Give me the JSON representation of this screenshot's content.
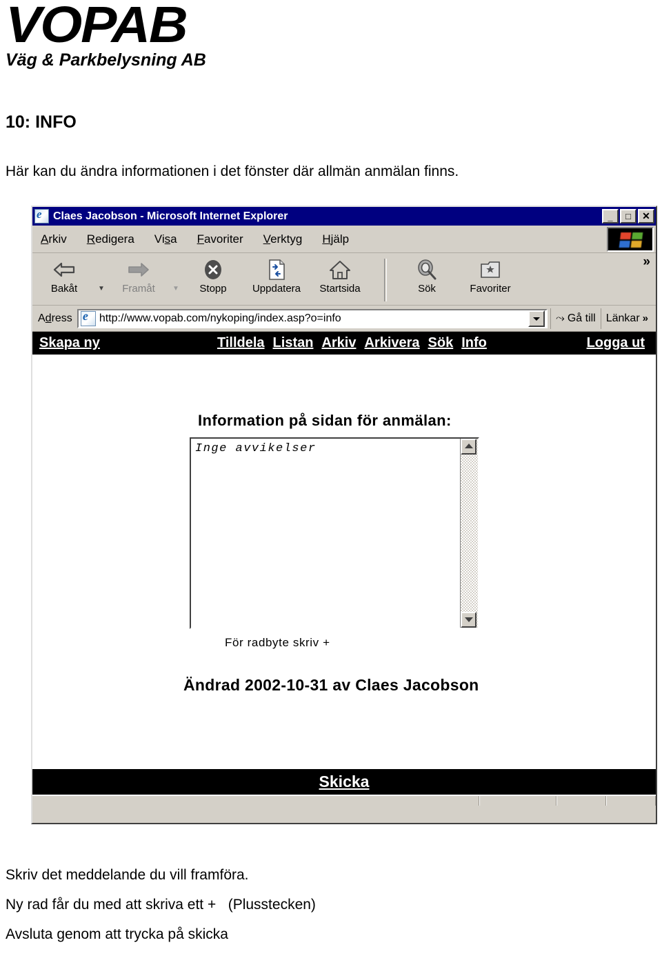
{
  "logo": {
    "word": "VOPAB",
    "tagline": "Väg & Parkbelysning AB"
  },
  "document": {
    "heading": "10: INFO",
    "intro": "Här kan du ändra informationen i det fönster där allmän anmälan finns.",
    "notes": [
      "Skriv det meddelande du vill framföra.",
      "Ny rad får du med att skriva ett +   (Plusstecken)",
      "Avsluta genom att trycka på skicka"
    ]
  },
  "browser": {
    "title": "Claes Jacobson - Microsoft Internet Explorer",
    "window_buttons": {
      "minimize": "_",
      "maximize": "□",
      "close": "✕"
    },
    "menu": [
      {
        "pre": "",
        "mn": "A",
        "post": "rkiv"
      },
      {
        "pre": "",
        "mn": "R",
        "post": "edigera"
      },
      {
        "pre": "Vi",
        "mn": "s",
        "post": "a"
      },
      {
        "pre": "",
        "mn": "F",
        "post": "avoriter"
      },
      {
        "pre": "",
        "mn": "V",
        "post": "erktyg"
      },
      {
        "pre": "",
        "mn": "H",
        "post": "jälp"
      }
    ],
    "toolbar": {
      "back": "Bakåt",
      "forward": "Framåt",
      "stop": "Stopp",
      "refresh": "Uppdatera",
      "home": "Startsida",
      "search": "Sök",
      "favorites": "Favoriter",
      "overflow": "»"
    },
    "address": {
      "label_pre": "A",
      "label_mn": "d",
      "label_post": "ress",
      "value": "http://www.vopab.com/nykoping/index.asp?o=info",
      "go": "Gå till",
      "links": "Länkar",
      "links_chevron": "»"
    }
  },
  "page": {
    "nav_left": "Skapa ny",
    "nav_center": [
      "Tilldela",
      "Listan",
      "Arkiv",
      "Arkivera",
      "Sök",
      "Info"
    ],
    "nav_right": "Logga ut",
    "info_heading": "Information på sidan för anmälan:",
    "textarea_value": "Inge avvikelser",
    "hint": "För radbyte skriv +",
    "changed": "Ändrad 2002-10-31 av Claes Jacobson",
    "submit": "Skicka"
  },
  "colors": {
    "title_bar": "#000080",
    "chrome": "#d4d0c8",
    "nav_strip": "#000000",
    "page_bg": "#ffffff"
  }
}
